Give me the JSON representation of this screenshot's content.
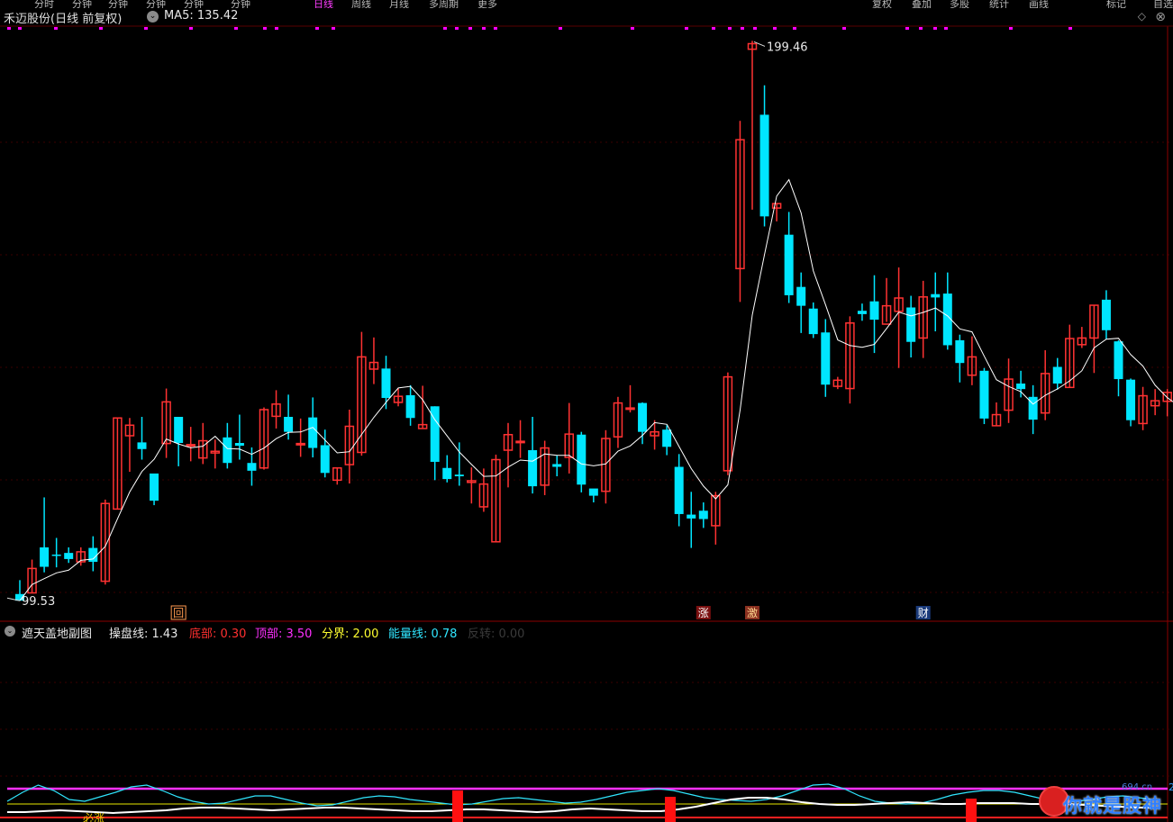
{
  "topbar": {
    "items": [
      "分时",
      "分钟",
      "分钟",
      "分钟",
      "分钟",
      "分钟",
      "日线",
      "周线",
      "月线",
      "多周期",
      "更多",
      "复权",
      "叠加",
      "多股",
      "统计",
      "画线",
      "标记",
      "自选"
    ],
    "active_index": 6
  },
  "title": {
    "stock": "禾迈股份(日线 前复权)",
    "ma_label": "MA5: 135.42"
  },
  "main_chart": {
    "price_range": [
      95,
      202
    ],
    "high_label": "199.46",
    "low_label": "99.53",
    "colors": {
      "up": "#ff3232",
      "down": "#00e6ff",
      "ma": "#ffffff",
      "grid": "#3a0000",
      "marker": "#ff00ff"
    },
    "candles": [
      [
        99.9,
        98.7,
        102.4,
        99.5
      ],
      [
        100.1,
        104.5,
        106.1,
        100.1
      ],
      [
        108.3,
        104.8,
        117.3,
        103.8
      ],
      [
        107,
        106.8,
        110,
        104.7
      ],
      [
        107.3,
        106.2,
        108.3,
        105.5
      ],
      [
        105.7,
        107.5,
        108.3,
        105
      ],
      [
        108.2,
        105.7,
        110.3,
        104
      ],
      [
        102.2,
        116.2,
        116.9,
        101.6
      ],
      [
        115.2,
        131.6,
        131.6,
        115.2
      ],
      [
        128.4,
        130.3,
        131.6,
        121.9
      ],
      [
        127.2,
        126,
        131.8,
        124.1
      ],
      [
        121.6,
        116.7,
        120.9,
        115.9
      ],
      [
        127,
        134.5,
        136.9,
        124.4
      ],
      [
        131.8,
        127.1,
        131.8,
        122.9
      ],
      [
        126.8,
        126.8,
        130,
        123.8
      ],
      [
        124.4,
        127.5,
        130.7,
        123.3
      ],
      [
        125.3,
        125.6,
        127.7,
        122.5
      ],
      [
        128.1,
        123.5,
        130.7,
        122.5
      ],
      [
        127.1,
        126.6,
        132.2,
        124.1
      ],
      [
        123.5,
        122.1,
        126.3,
        119.4
      ],
      [
        122.6,
        133.1,
        133.5,
        122.3
      ],
      [
        131.9,
        134.1,
        136.6,
        129.7
      ],
      [
        131.8,
        129.1,
        135.8,
        127.7
      ],
      [
        126.9,
        127,
        131.5,
        124.6
      ],
      [
        131.7,
        126.2,
        135.3,
        124.5
      ],
      [
        126.7,
        121.7,
        129.5,
        120.9
      ],
      [
        120.4,
        122.6,
        122.6,
        119.6
      ],
      [
        123.2,
        130.1,
        133.1,
        119.8
      ],
      [
        125.4,
        142.6,
        147.1,
        124.8
      ],
      [
        140.4,
        141.6,
        146.1,
        137.7
      ],
      [
        140.5,
        135.2,
        142.8,
        133.2
      ],
      [
        134.4,
        135.5,
        136.9,
        133.7
      ],
      [
        135.7,
        131.6,
        137.5,
        130.2
      ],
      [
        129.7,
        130.4,
        137.4,
        129.8
      ],
      [
        133.7,
        123.7,
        133.7,
        120.4
      ],
      [
        122.6,
        120.6,
        124.9,
        120
      ],
      [
        121.4,
        121.1,
        127.2,
        119.4
      ],
      [
        120,
        120.3,
        122.7,
        116.2
      ],
      [
        115.6,
        119.7,
        122.5,
        114.7
      ],
      [
        109.3,
        124.1,
        125,
        109.3
      ],
      [
        125.8,
        128.6,
        130.7,
        119.1
      ],
      [
        127.3,
        127.4,
        131.2,
        124.4
      ],
      [
        125.8,
        119.3,
        131.8,
        118
      ],
      [
        119.5,
        126.2,
        127.5,
        117.7
      ],
      [
        123.3,
        122.8,
        124.9,
        121.1
      ],
      [
        124.5,
        128.7,
        134.3,
        121.6
      ],
      [
        128.6,
        119.6,
        129.1,
        118.2
      ],
      [
        118.9,
        117.6,
        118.6,
        116.4
      ],
      [
        118.4,
        127.9,
        129.4,
        116.2
      ],
      [
        128.2,
        134.3,
        135.4,
        126.2
      ],
      [
        133.2,
        133.4,
        137.5,
        132.6
      ],
      [
        134.3,
        129.1,
        134.4,
        126.9
      ],
      [
        128.4,
        129.1,
        131.2,
        125.9
      ],
      [
        129.5,
        126.4,
        130.3,
        124.9
      ],
      [
        122.8,
        114.3,
        125.1,
        112.1
      ],
      [
        114.2,
        113.5,
        118.3,
        108.2
      ],
      [
        114.9,
        113.4,
        116.4,
        111.8
      ],
      [
        112.2,
        117.6,
        118.3,
        108.8
      ],
      [
        122.1,
        139,
        139.8,
        121.3
      ],
      [
        158.5,
        181.7,
        185.1,
        152.5
      ],
      [
        198,
        199,
        199.5,
        169.1
      ],
      [
        186.2,
        167.9,
        191.5,
        166.1
      ],
      [
        169.4,
        170.2,
        170.2,
        167
      ],
      [
        164.6,
        153.7,
        168.7,
        152.3
      ],
      [
        155.2,
        151.8,
        157.8,
        146.9
      ],
      [
        151.3,
        146.7,
        152.4,
        146
      ],
      [
        147,
        137.6,
        149.4,
        135.4
      ],
      [
        137.3,
        138.4,
        139,
        136.8
      ],
      [
        136.9,
        148.7,
        149.9,
        134.2
      ],
      [
        150.9,
        150.3,
        152.2,
        149.1
      ],
      [
        152.6,
        149.3,
        157.3,
        143.3
      ],
      [
        148.5,
        151.8,
        156.8,
        148.9
      ],
      [
        150.8,
        153.2,
        158.7,
        140.6
      ],
      [
        151.5,
        145.3,
        153.6,
        142.5
      ],
      [
        146,
        153.4,
        156.3,
        142.4
      ],
      [
        153.9,
        153.3,
        157.8,
        147.2
      ],
      [
        154,
        144.7,
        157.8,
        143.9
      ],
      [
        145.6,
        141.5,
        146.6,
        138
      ],
      [
        139.3,
        142.6,
        146.3,
        137.5
      ],
      [
        140.1,
        131.5,
        140.6,
        130.5
      ],
      [
        130.2,
        132.2,
        134.4,
        130.1
      ],
      [
        133,
        138.6,
        142.3,
        130.7
      ],
      [
        137.8,
        136.8,
        140.1,
        135.3
      ],
      [
        135.4,
        131.3,
        137.5,
        128.7
      ],
      [
        132.5,
        139.6,
        143.8,
        131.2
      ],
      [
        140.8,
        137.8,
        142.4,
        136.7
      ],
      [
        137.1,
        145.9,
        148.4,
        137
      ],
      [
        144.8,
        146,
        148,
        144.2
      ],
      [
        146,
        151.9,
        151.9,
        139.7
      ],
      [
        152.9,
        147.4,
        154.6,
        145.8
      ],
      [
        145.4,
        138.6,
        145.6,
        135.5
      ],
      [
        138.5,
        131.2,
        138.7,
        130.1
      ],
      [
        130.6,
        135.6,
        137.2,
        129.4
      ],
      [
        133.8,
        134.7,
        136.8,
        132.1
      ],
      [
        134.6,
        136.2,
        136.8,
        131.9
      ],
      [
        135.6,
        130.7,
        136.7,
        130.6
      ]
    ],
    "tags": [
      {
        "text": "回",
        "index": 13,
        "color": "#ff9a50",
        "border": "#ff9a50"
      },
      {
        "text": "涨",
        "index": 56,
        "color": "#ffffff",
        "bg": "#7a1010"
      },
      {
        "text": "激",
        "index": 60,
        "color": "#ffd890",
        "bg": "#8a3020"
      },
      {
        "text": "财",
        "index": 74,
        "color": "#ffffff",
        "bg": "#1a3a7a"
      }
    ]
  },
  "sub_chart": {
    "title": "遮天盖地副图",
    "items": [
      {
        "label": "操盘线:",
        "value": "1.43",
        "color": "#e8e8e8"
      },
      {
        "label": "底部:",
        "value": "0.30",
        "color": "#ff3030"
      },
      {
        "label": "顶部:",
        "value": "3.50",
        "color": "#ff30ff"
      },
      {
        "label": "分界:",
        "value": "2.00",
        "color": "#ffff30"
      },
      {
        "label": "能量线:",
        "value": "0.78",
        "color": "#30e6ff"
      },
      {
        "label": "反转:",
        "value": "0.00",
        "color": "#3a3a3a"
      }
    ],
    "bottom_text": "必涨",
    "axis_tick": "2"
  },
  "watermark": {
    "text": "你就是股神",
    "url": "694.cn"
  }
}
